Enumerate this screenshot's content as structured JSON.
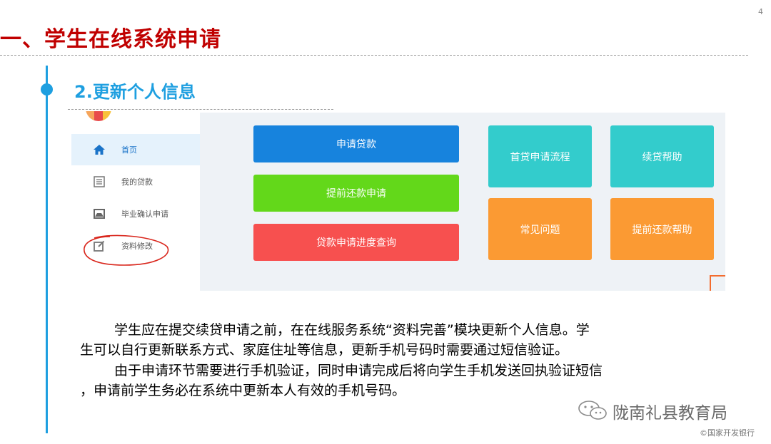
{
  "page_number": "4",
  "title": "一、学生在线系统申请",
  "section": {
    "title": "2.更新个人信息"
  },
  "screenshot": {
    "sidebar": {
      "items": [
        {
          "label": "首页",
          "icon": "home-icon"
        },
        {
          "label": "我的贷款",
          "icon": "list-icon"
        },
        {
          "label": "毕业确认申请",
          "icon": "inbox-icon"
        },
        {
          "label": "资料修改",
          "icon": "edit-icon"
        }
      ]
    },
    "tiles": {
      "apply_loan": {
        "label": "申请贷款",
        "color": "#1783dd"
      },
      "early_repay": {
        "label": "提前还款申请",
        "color": "#63d81a"
      },
      "progress_query": {
        "label": "贷款申请进度查询",
        "color": "#f7504f"
      },
      "first_loan_flow": {
        "label": "首贷申请流程",
        "color": "#33cccc"
      },
      "renew_help": {
        "label": "续贷帮助",
        "color": "#33cccc"
      },
      "faq": {
        "label": "常见问题",
        "color": "#fb9a33"
      },
      "early_repay_help": {
        "label": "提前还款帮助",
        "color": "#fb9a33"
      }
    }
  },
  "body_text": {
    "line1": "学生应在提交续贷申请之前，在在线服务系统“资料完善”模块更新个人信息。学",
    "line2": "生可以自行更新联系方式、家庭住址等信息，更新手机号码时需要通过短信验证。",
    "line3": "由于申请环节需要进行手机验证，同时申请完成后将向学生手机发送回执验证短信",
    "line4": "，申请前学生务必在系统中更新本人有效的手机号码。"
  },
  "watermark": {
    "text": "陇南礼县教育局",
    "icon": "wechat-icon"
  },
  "copyright": "©国家开发银行",
  "colors": {
    "title": "#c00000",
    "accent": "#1e9fe0",
    "annotation": "#d9261c"
  }
}
